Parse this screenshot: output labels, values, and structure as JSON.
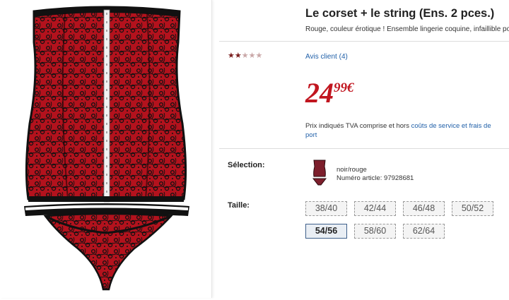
{
  "product": {
    "title": "Le corset + le string (Ens. 2 pces.)",
    "subtitle": "Rouge, couleur érotique ! Ensemble lingerie coquine, infaillible pour"
  },
  "rating": {
    "value": 2,
    "max": 5
  },
  "reviews_link": "Avis client (4)",
  "price": {
    "whole": "24",
    "cents": "99€",
    "color": "#c1151f"
  },
  "tva": {
    "text": "Prix indiqués TVA comprise et hors ",
    "link": "coûts de service et frais de port"
  },
  "selection": {
    "label": "Sélection:",
    "color": "noir/rouge",
    "article": "Numéro article: 97928681"
  },
  "size": {
    "label": "Taille:",
    "options": [
      "38/40",
      "42/44",
      "46/48",
      "50/52",
      "54/56",
      "58/60",
      "62/64"
    ],
    "selected": "54/56"
  }
}
